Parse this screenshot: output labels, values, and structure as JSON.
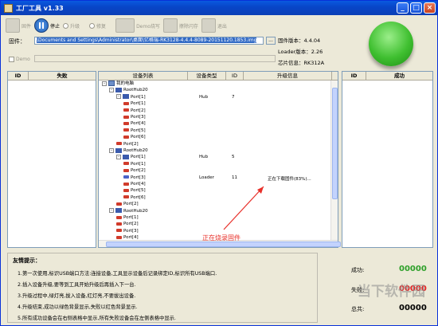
{
  "window": {
    "title": "工厂工具 v1.33",
    "min": "_",
    "max": "□",
    "close": "×"
  },
  "toolbar": {
    "items": [
      {
        "label": "固件"
      },
      {
        "label": "停止"
      },
      {
        "label": "升级"
      },
      {
        "label": "修复"
      },
      {
        "label": "Demo烧写"
      },
      {
        "label": "擦除闪存"
      },
      {
        "label": "退出"
      }
    ]
  },
  "firmware": {
    "label": "固件：",
    "value": "\\Documents and Settings\\Administrator\\桌面\\亿格瑞-RK3128-4.4.4-8089-20151120.1853.img",
    "browse": "..."
  },
  "info": {
    "fw_version": "固件版本：4.4.04",
    "loader_version": "Loader版本：2.26",
    "chip": "芯片信息：RK312A"
  },
  "demo": {
    "label": "Demo"
  },
  "fail_panel": {
    "col_id": "ID",
    "col_name": "失败"
  },
  "success_panel": {
    "col_id": "ID",
    "col_name": "成功"
  },
  "main_panel": {
    "columns": [
      "设备列表",
      "设备类型",
      "ID",
      "升级信息"
    ]
  },
  "tree": [
    {
      "indent": 0,
      "kind": "pc",
      "pm": "-",
      "label": "我的电脑"
    },
    {
      "indent": 1,
      "kind": "hub",
      "pm": "-",
      "label": "RootHub20"
    },
    {
      "indent": 2,
      "kind": "hub",
      "pm": "-",
      "label": "Port[1]",
      "type": "Hub",
      "id": "7"
    },
    {
      "indent": 3,
      "kind": "usb",
      "label": "Port[1]"
    },
    {
      "indent": 3,
      "kind": "usb",
      "label": "Port[2]"
    },
    {
      "indent": 3,
      "kind": "usb",
      "label": "Port[3]"
    },
    {
      "indent": 3,
      "kind": "usb",
      "label": "Port[4]"
    },
    {
      "indent": 3,
      "kind": "usb",
      "label": "Port[5]"
    },
    {
      "indent": 3,
      "kind": "usb",
      "label": "Port[6]"
    },
    {
      "indent": 2,
      "kind": "usb",
      "label": "Port[2]"
    },
    {
      "indent": 1,
      "kind": "hub",
      "pm": "-",
      "label": "RootHub20"
    },
    {
      "indent": 2,
      "kind": "hub",
      "pm": "-",
      "label": "Port[1]",
      "type": "Hub",
      "id": "5"
    },
    {
      "indent": 3,
      "kind": "usb",
      "label": "Port[1]"
    },
    {
      "indent": 3,
      "kind": "usb",
      "label": "Port[2]"
    },
    {
      "indent": 3,
      "kind": "usbblue",
      "label": "Port[3]",
      "type": "Loader",
      "id": "11",
      "info": "正在下载固件(83%)..."
    },
    {
      "indent": 3,
      "kind": "usb",
      "label": "Port[4]"
    },
    {
      "indent": 3,
      "kind": "usb",
      "label": "Port[5]"
    },
    {
      "indent": 3,
      "kind": "usb",
      "label": "Port[6]"
    },
    {
      "indent": 2,
      "kind": "usb",
      "label": "Port[2]"
    },
    {
      "indent": 1,
      "kind": "hub",
      "pm": "-",
      "label": "RootHub20"
    },
    {
      "indent": 2,
      "kind": "usb",
      "label": "Port[1]"
    },
    {
      "indent": 2,
      "kind": "usb",
      "label": "Port[2]"
    },
    {
      "indent": 2,
      "kind": "usb",
      "label": "Port[3]"
    },
    {
      "indent": 2,
      "kind": "usb",
      "label": "Port[4]"
    }
  ],
  "annotation": "正在烧录固件",
  "tips": {
    "title": "友情提示：",
    "lines": [
      "1.第一次使用,标识USB端口方法:连接设备,工具显示设备后记录绑定ID,标识所有USB端口.",
      "2.插入设备升级,要等到工具开始升级后再插入下一台.",
      "3.升级过程中,绿灯亮,拔入设备,红灯亮,不要拔出设备.",
      "4.升级结束,成功以绿色背景显示,失败以红色背景显示.",
      "5.所有成功设备会在右侧表格中显示,所有失败设备会在左侧表格中显示."
    ]
  },
  "stats": {
    "success_label": "成功:",
    "success_value": "00000",
    "fail_label": "失败:",
    "fail_value": "00000",
    "total_label": "总共:",
    "total_value": "00000",
    "success_color": "#2ea02a",
    "fail_color": "#e82020"
  },
  "watermark": "当下软件园"
}
